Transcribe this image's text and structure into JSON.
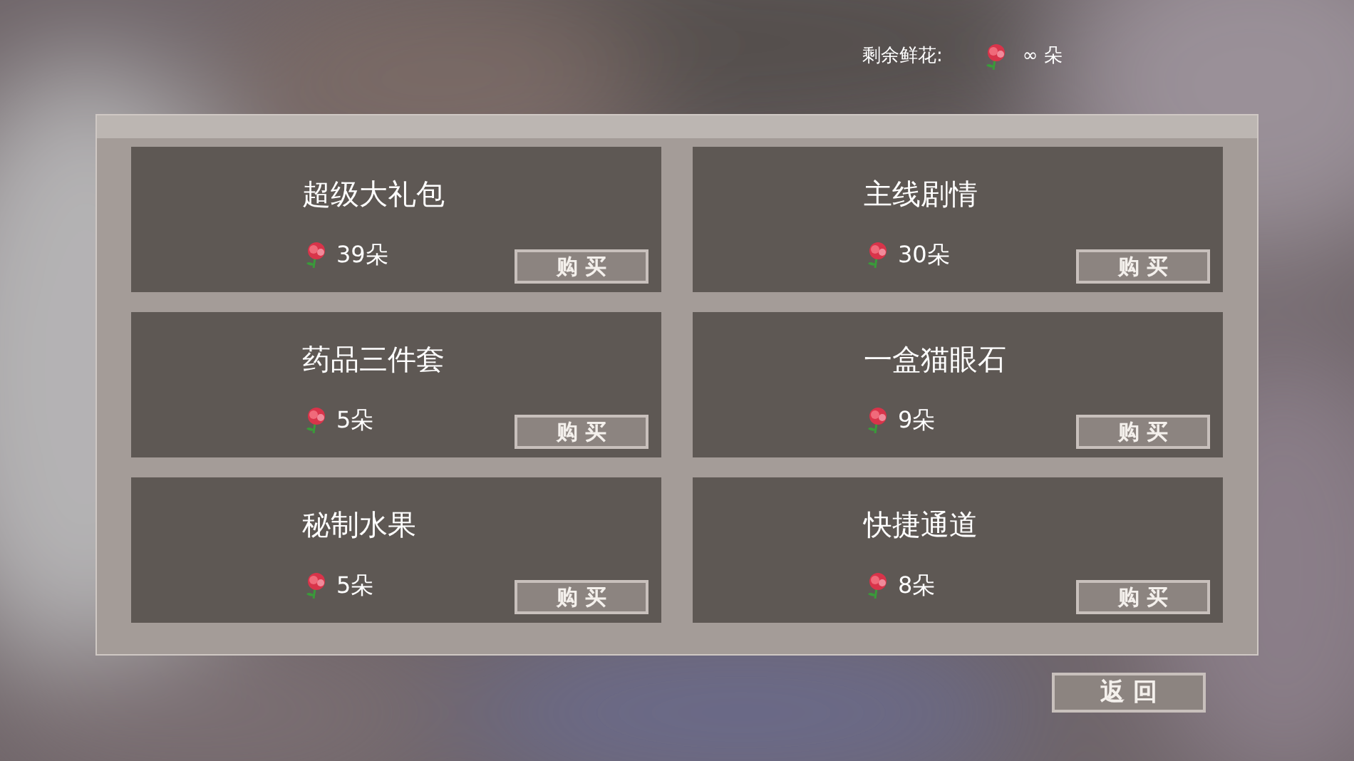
{
  "header": {
    "label": "剩余鲜花:",
    "value": "∞ 朵"
  },
  "items": [
    {
      "title": "超级大礼包",
      "price": "39朵",
      "button": "购 买"
    },
    {
      "title": "主线剧情",
      "price": "30朵",
      "button": "购 买"
    },
    {
      "title": "药品三件套",
      "price": "5朵",
      "button": "购 买"
    },
    {
      "title": "一盒猫眼石",
      "price": "9朵",
      "button": "购 买"
    },
    {
      "title": "秘制水果",
      "price": "5朵",
      "button": "购 买"
    },
    {
      "title": "快捷通道",
      "price": "8朵",
      "button": "购 买"
    }
  ],
  "back_button": "返 回"
}
